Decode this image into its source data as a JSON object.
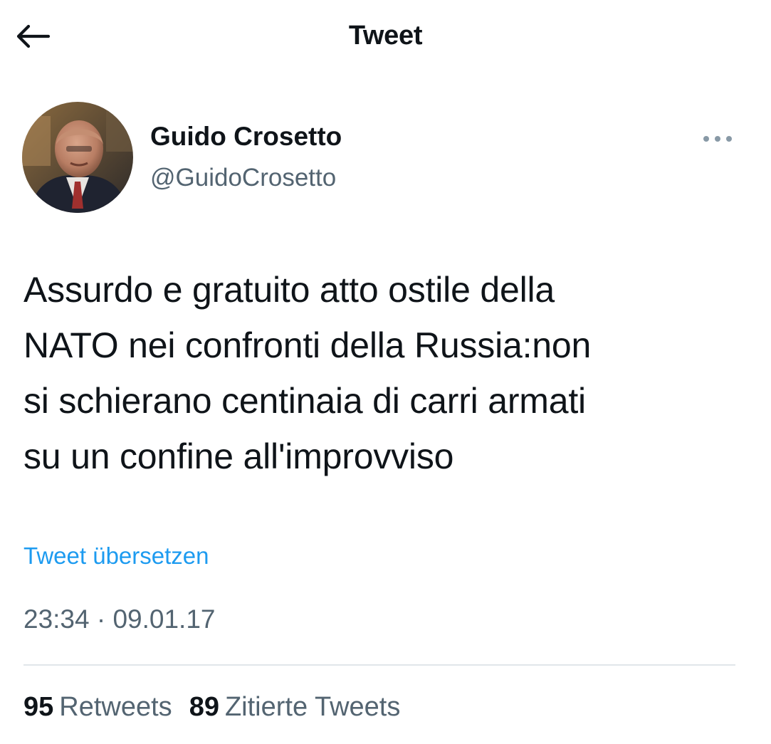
{
  "header": {
    "title": "Tweet",
    "back_icon": "arrow-left-icon"
  },
  "author": {
    "name": "Guido Crosetto",
    "handle": "@GuidoCrosetto",
    "avatar_icon": "user-avatar-photo",
    "more_icon": "more-horizontal-icon"
  },
  "tweet": {
    "lines": [
      "Assurdo e gratuito atto ostile della",
      "NATO nei confronti della Russia:non",
      "si schierano centinaia di carri armati",
      "su un confine all'improvviso"
    ],
    "translate_label": "Tweet übersetzen",
    "timestamp": "23:34 · 09.01.17"
  },
  "stats": {
    "retweets": {
      "count": "95",
      "label": "Retweets"
    },
    "quotes": {
      "count": "89",
      "label": "Zitierte Tweets"
    }
  },
  "colors": {
    "text": "#0f1419",
    "secondary": "#536471",
    "link": "#1d9bf0",
    "divider": "#e1e6ea"
  }
}
